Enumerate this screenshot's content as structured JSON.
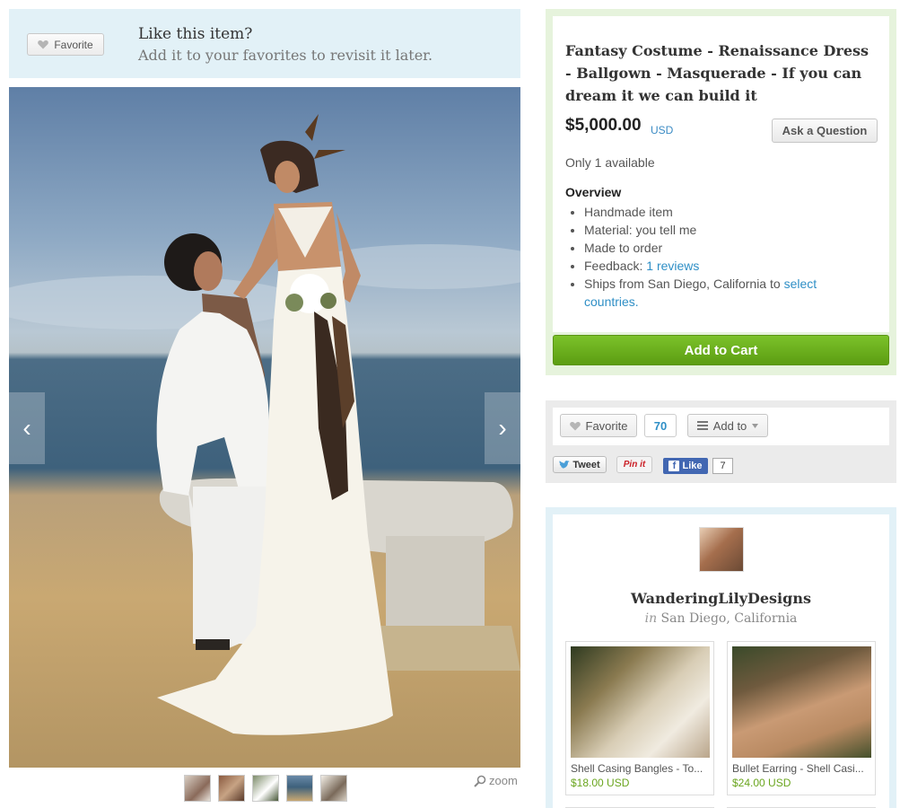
{
  "favorite_banner": {
    "button_label": "Favorite",
    "title": "Like this item?",
    "subtitle": "Add it to your favorites to revisit it later."
  },
  "gallery": {
    "thumbnail_count": 5,
    "zoom_label": "zoom",
    "prev_glyph": "‹",
    "next_glyph": "›"
  },
  "listing": {
    "title": "Fantasy Costume - Renaissance Dress - Ballgown - Masquerade - If you can dream it we can build it",
    "price": "$5,000.00",
    "currency": "USD",
    "ask_button": "Ask a Question",
    "availability": "Only 1 available",
    "overview_heading": "Overview",
    "overview": {
      "handmade": "Handmade item",
      "material": "Material: you tell me",
      "made_to_order": "Made to order",
      "feedback_label": "Feedback: ",
      "feedback_link": "1 reviews",
      "ships_label": "Ships from San Diego, California to ",
      "ships_link": "select countries."
    },
    "add_to_cart": "Add to Cart"
  },
  "social": {
    "favorite_label": "Favorite",
    "favorite_count": "70",
    "add_to_label": "Add to",
    "tweet_label": "Tweet",
    "pinit_label": "Pin it",
    "like_label": "Like",
    "like_count": "7"
  },
  "shop": {
    "name": "WanderingLilyDesigns",
    "location_prefix": "in",
    "location": "San Diego, California",
    "items": [
      {
        "title": "Shell Casing Bangles - To...",
        "price": "$18.00 USD"
      },
      {
        "title": "Bullet Earring - Shell Casi...",
        "price": "$24.00 USD"
      }
    ]
  },
  "colors": {
    "accent_blue": "#2f8fc6",
    "cart_green": "#6aae1f",
    "price_green": "#6aa51e",
    "banner_blue": "#e2f1f7",
    "buy_box_green": "#e6f3dc"
  }
}
